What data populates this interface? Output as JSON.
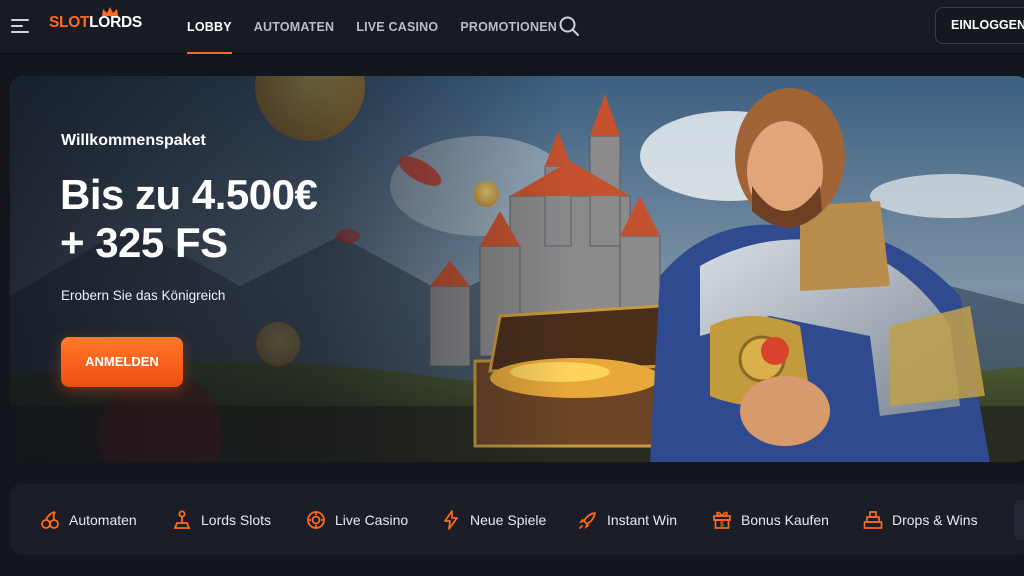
{
  "header": {
    "logo": {
      "part1": "SLOT",
      "part2": "LORDS"
    },
    "nav": [
      {
        "label": "LOBBY",
        "active": true
      },
      {
        "label": "AUTOMATEN",
        "active": false
      },
      {
        "label": "LIVE CASINO",
        "active": false
      },
      {
        "label": "PROMOTIONEN",
        "active": false
      }
    ],
    "search_icon": "search-icon",
    "login_label": "EINLOGGEN"
  },
  "hero": {
    "kicker": "Willkommenspaket",
    "title_line1": "Bis zu 4.500€",
    "title_line2": "+ 325 FS",
    "subtitle": "Erobern Sie das Königreich",
    "cta_label": "ANMELDEN"
  },
  "categories": [
    {
      "label": "Automaten",
      "icon": "cherries-icon"
    },
    {
      "label": "Lords Slots",
      "icon": "joystick-icon"
    },
    {
      "label": "Live Casino",
      "icon": "chip-icon"
    },
    {
      "label": "Neue Spiele",
      "icon": "lightning-icon"
    },
    {
      "label": "Instant Win",
      "icon": "rocket-icon"
    },
    {
      "label": "Bonus Kaufen",
      "icon": "gift-dollar-icon"
    },
    {
      "label": "Drops & Wins",
      "icon": "pyramid-icon"
    }
  ],
  "colors": {
    "accent": "#ff6a1f",
    "background": "#13161d",
    "panel": "#1b1e27"
  }
}
